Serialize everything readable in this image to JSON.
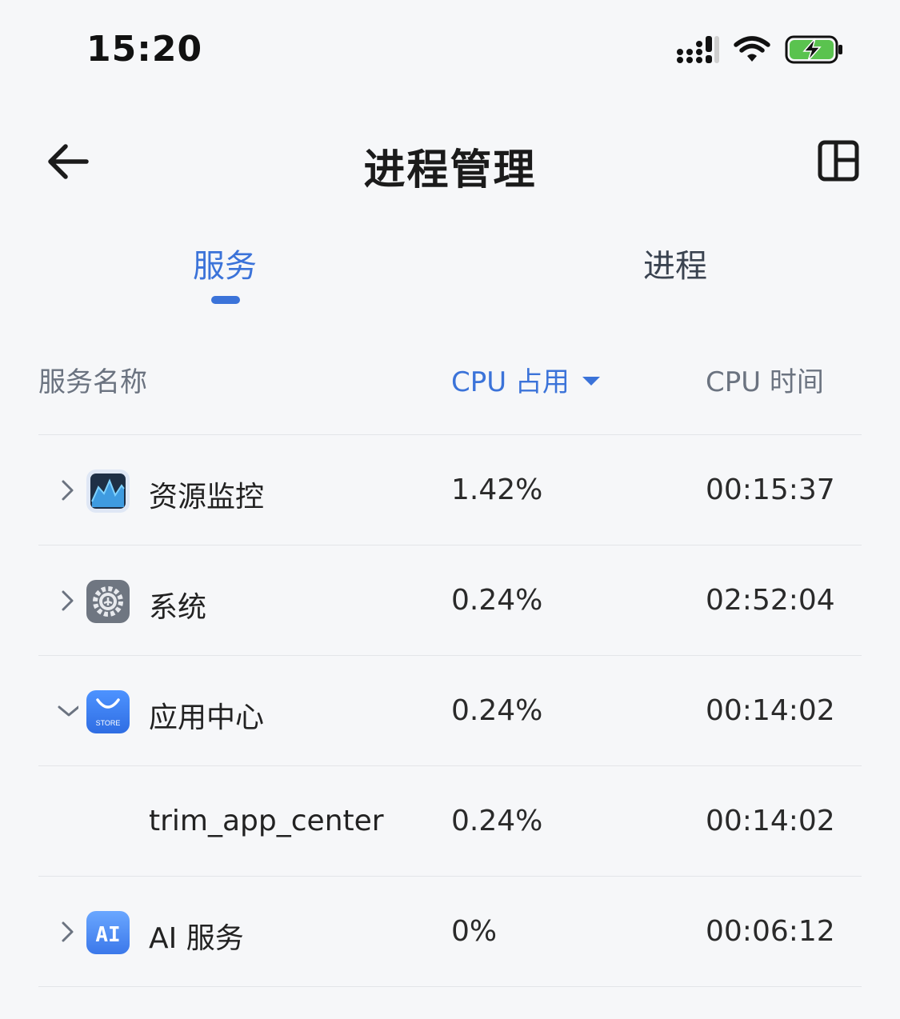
{
  "status": {
    "time": "15:20"
  },
  "nav": {
    "title": "进程管理"
  },
  "tabs": [
    {
      "label": "服务",
      "active": true
    },
    {
      "label": "进程",
      "active": false
    }
  ],
  "header": {
    "name": "服务名称",
    "cpu": "CPU 占用",
    "time": "CPU 时间"
  },
  "colors": {
    "accent": "#3b73d9",
    "battery": "#5ac34f"
  },
  "rows": [
    {
      "name": "资源监控",
      "cpu": "1.42%",
      "time": "00:15:37",
      "icon": "resource-monitor-icon",
      "expanded": false
    },
    {
      "name": "系统",
      "cpu": "0.24%",
      "time": "02:52:04",
      "icon": "system-settings-icon",
      "expanded": false
    },
    {
      "name": "应用中心",
      "cpu": "0.24%",
      "time": "00:14:02",
      "icon": "app-store-icon",
      "icon_text": "STORE",
      "expanded": true
    },
    {
      "name": "trim_app_center",
      "cpu": "0.24%",
      "time": "00:14:02",
      "child": true
    },
    {
      "name": "AI 服务",
      "cpu": "0%",
      "time": "00:06:12",
      "icon": "ai-service-icon",
      "icon_text": "AI",
      "expanded": false
    }
  ]
}
